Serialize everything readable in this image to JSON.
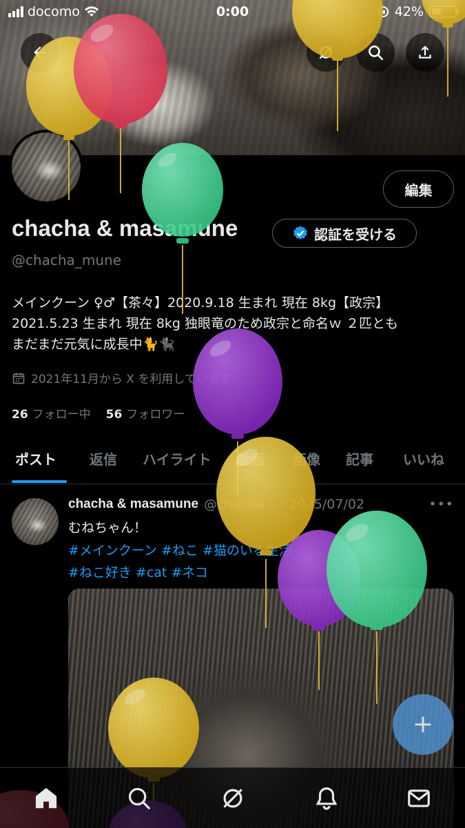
{
  "status_bar": {
    "carrier": "docomo",
    "time": "0:00",
    "battery": "42%",
    "battery_level": 0.42
  },
  "header": {
    "back_icon": "back-arrow-icon",
    "grok_icon": "grok-icon",
    "search_icon": "search-icon",
    "share_icon": "share-icon"
  },
  "profile": {
    "edit_label": "編集",
    "display_name": "chacha & masamune",
    "verify_label": "認証を受ける",
    "handle": "@chacha_mune",
    "bio_line1": "メインクーン ♀♂【茶々】2020.9.18 生まれ 現在 8kg【政宗】",
    "bio_line2": "2021.5.23 生まれ 現在 8kg 独眼竜のため政宗と命名ｗ ２匹とも",
    "bio_line3": "まだまだ元気に成長中🐈🐈‍⬛",
    "joined": "2021年11月から X を利用しています",
    "following_count": "26",
    "following_label": "フォロー中",
    "followers_count": "56",
    "followers_label": "フォロワー"
  },
  "tabs": [
    "ポスト",
    "返信",
    "ハイライト",
    "動画",
    "画像",
    "記事",
    "いいね"
  ],
  "post": {
    "name": "chacha & masamune",
    "meta": "@chacha... · 2025/07/02",
    "more": "•••",
    "text": "むねちゃん！",
    "hashtags_line1": [
      "#メインクーン",
      "#ねこ",
      "#猫のいる生活"
    ],
    "hashtags_line2": [
      "#ねこ好き",
      "#cat",
      "#ネコ"
    ]
  },
  "colors": {
    "accent": "#1d9bf0",
    "balloon_yellow": "#e8c230",
    "balloon_red": "#e8455f",
    "balloon_green": "#4fd89a",
    "balloon_purple": "#9a3fd0"
  }
}
